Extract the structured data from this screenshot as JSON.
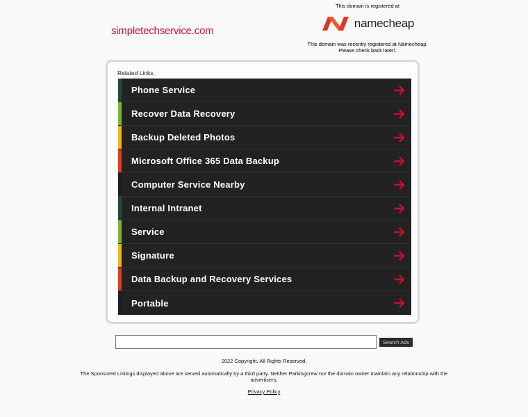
{
  "header": {
    "domain": "simpletechservice.com",
    "registrar_top": "This domain is registered at",
    "registrar_name": "namecheap",
    "registrar_note_line1": "This domain was recently registered at Namecheap.",
    "registrar_note_line2": "Please check back later!.",
    "brand_color": "#de3723"
  },
  "related": {
    "title": "Related Links",
    "arrow_color": "#c8102e",
    "links": [
      {
        "label": "Phone Service",
        "accent": "#1e4d35"
      },
      {
        "label": "Recover Data Recovery",
        "accent": "#7cb82f"
      },
      {
        "label": "Backup Deleted Photos",
        "accent": "#f2b705"
      },
      {
        "label": "Microsoft Office 365 Data Backup",
        "accent": "#e03a1e"
      },
      {
        "label": "Computer Service Nearby",
        "accent": "#1a1f2b"
      },
      {
        "label": "Internal Intranet",
        "accent": "#1e4d35"
      },
      {
        "label": "Service",
        "accent": "#7cb82f"
      },
      {
        "label": "Signature",
        "accent": "#f2b705"
      },
      {
        "label": "Data Backup and Recovery Services",
        "accent": "#e03a1e"
      },
      {
        "label": "Portable",
        "accent": "#1a1f2b"
      }
    ]
  },
  "search": {
    "value": "",
    "button_label": "Search Ads"
  },
  "footer": {
    "copyright": "2022 Copyright. All Rights Reserved.",
    "disclaimer_line1": "The Sponsored Listings displayed above are served automatically by a third party. Neither Parkingcrew nor the domain owner maintain any relationship with the",
    "disclaimer_line2": "advertisers.",
    "privacy": "Privacy Policy"
  }
}
